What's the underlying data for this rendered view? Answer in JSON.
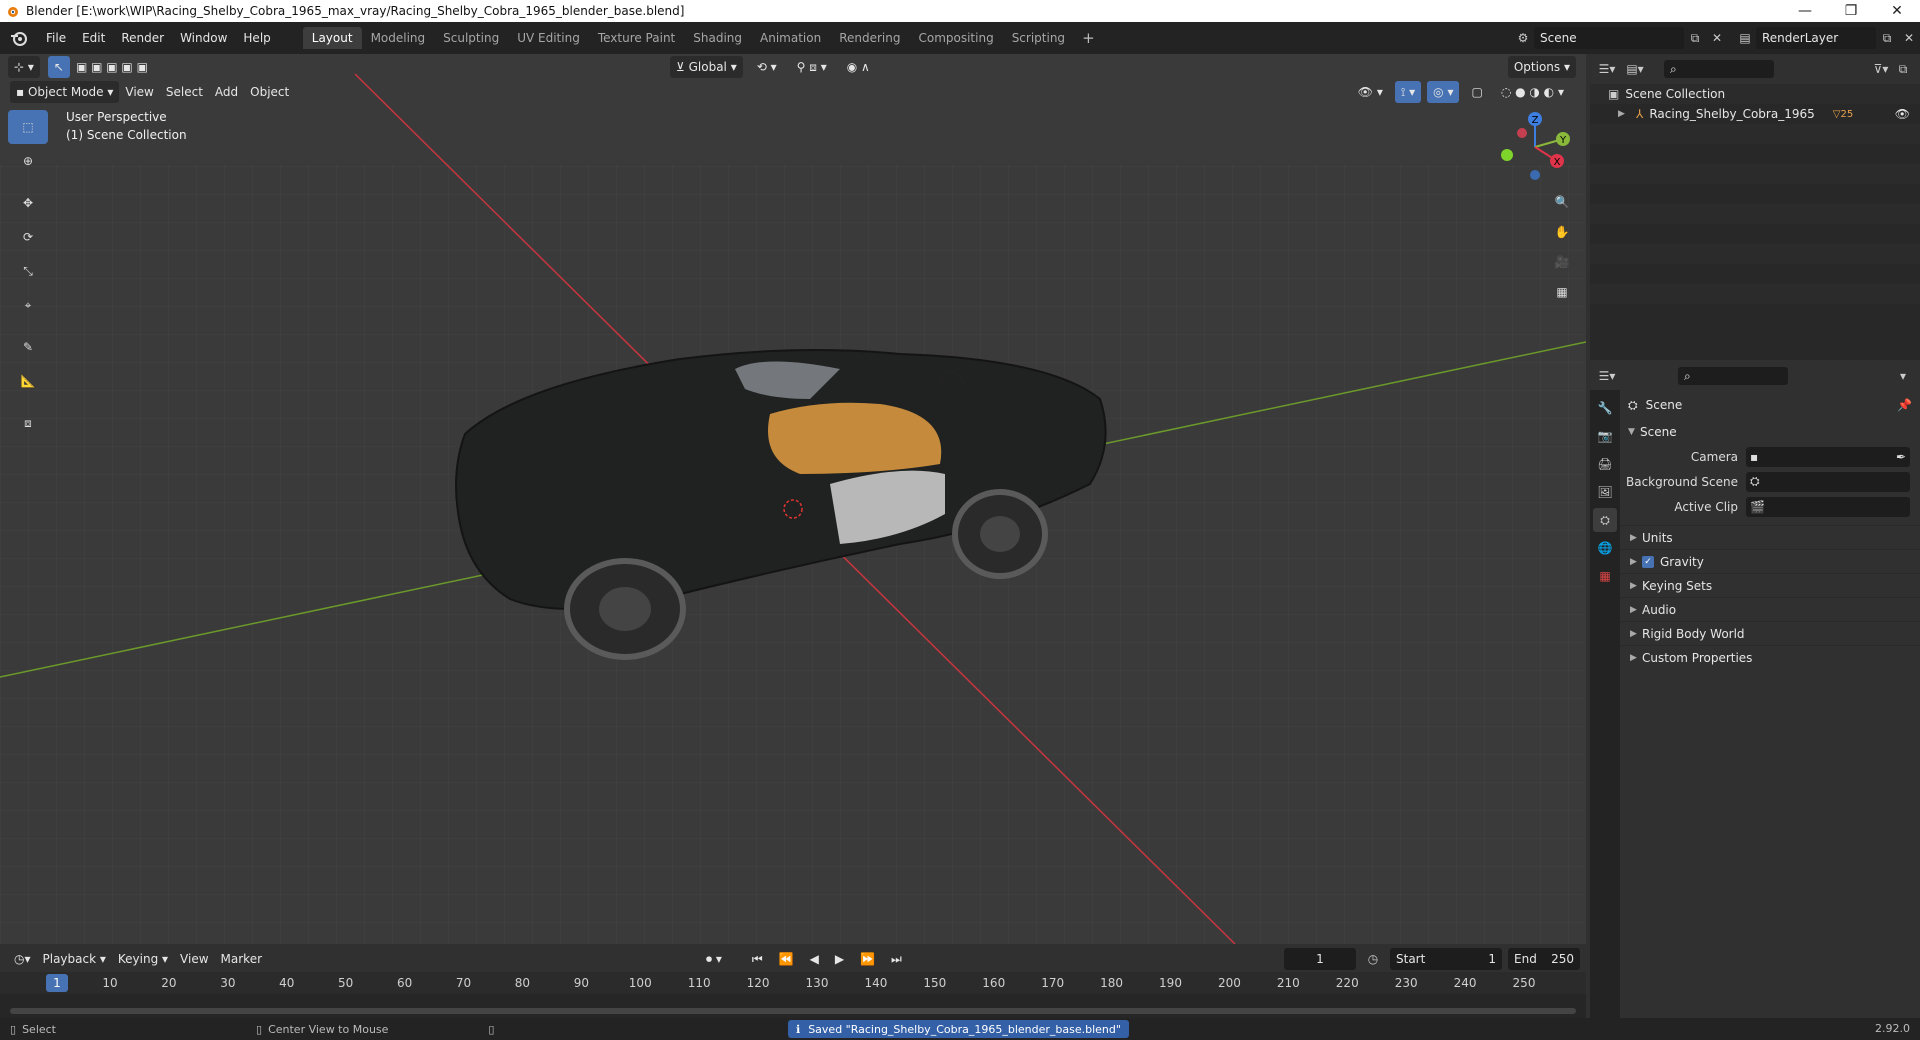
{
  "window": {
    "title": "Blender [E:\\work\\WIP\\Racing_Shelby_Cobra_1965_max_vray/Racing_Shelby_Cobra_1965_blender_base.blend]",
    "minimize": "—",
    "restore": "❐",
    "close": "✕"
  },
  "menu": [
    "File",
    "Edit",
    "Render",
    "Window",
    "Help"
  ],
  "workspaces": {
    "tabs": [
      "Layout",
      "Modeling",
      "Sculpting",
      "UV Editing",
      "Texture Paint",
      "Shading",
      "Animation",
      "Rendering",
      "Compositing",
      "Scripting"
    ],
    "active": "Layout",
    "add": "+"
  },
  "topright": {
    "scene": "Scene",
    "view_layer": "RenderLayer"
  },
  "viewport": {
    "transform_orientation": "Global",
    "options": "Options",
    "mode": "Object Mode",
    "menus": [
      "View",
      "Select",
      "Add",
      "Object"
    ],
    "overlay_title": "User Perspective",
    "overlay_collection": "(1) Scene Collection",
    "gizmo": {
      "x": "X",
      "y": "Y",
      "z": "Z"
    }
  },
  "outliner": {
    "root": "Scene Collection",
    "items": [
      {
        "name": "Racing_Shelby_Cobra_1965",
        "badge": "25"
      }
    ]
  },
  "properties": {
    "context": "Scene",
    "panel": "Scene",
    "fields": [
      {
        "label": "Camera",
        "value": ""
      },
      {
        "label": "Background Scene",
        "value": ""
      },
      {
        "label": "Active Clip",
        "value": ""
      }
    ],
    "subpanels": [
      "Units",
      "Gravity",
      "Keying Sets",
      "Audio",
      "Rigid Body World",
      "Custom Properties"
    ]
  },
  "timeline": {
    "menus": [
      "Playback",
      "Keying",
      "View",
      "Marker"
    ],
    "current_frame": "1",
    "start_label": "Start",
    "start": "1",
    "end_label": "End",
    "end": "250",
    "ticks": [
      "1",
      "10",
      "20",
      "30",
      "40",
      "50",
      "60",
      "70",
      "80",
      "90",
      "100",
      "110",
      "120",
      "130",
      "140",
      "150",
      "160",
      "170",
      "180",
      "190",
      "200",
      "210",
      "220",
      "230",
      "240",
      "250"
    ],
    "frame_range": [
      1,
      250
    ]
  },
  "status": {
    "left": "Select",
    "middle": "Center View to Mouse",
    "message": "Saved \"Racing_Shelby_Cobra_1965_blender_base.blend\"",
    "version": "2.92.0"
  },
  "colors": {
    "accent": "#4772b3",
    "axis_x": "#c8353f",
    "axis_y": "#6b9a2a"
  }
}
